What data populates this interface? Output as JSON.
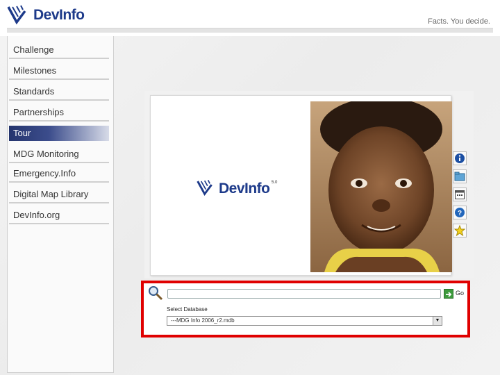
{
  "header": {
    "logo_text": "DevInfo",
    "tagline": "Facts. You decide."
  },
  "sidebar": {
    "items": [
      {
        "label": "Challenge",
        "active": false
      },
      {
        "label": "Milestones",
        "active": false
      },
      {
        "label": "Standards",
        "active": false
      },
      {
        "label": "Partnerships",
        "active": false
      },
      {
        "label": "Tour",
        "active": true
      },
      {
        "label": "MDG Monitoring",
        "active": false
      },
      {
        "label": "Emergency.Info",
        "active": false
      },
      {
        "label": "Digital Map Library",
        "active": false
      },
      {
        "label": "DevInfo.org",
        "active": false
      }
    ]
  },
  "main": {
    "logo_text": "DevInfo",
    "logo_mark": "5.0",
    "side_icons": [
      "info-icon",
      "folder-icon",
      "calendar-icon",
      "help-icon",
      "star-icon"
    ]
  },
  "search": {
    "input_value": "",
    "go_label": "Go",
    "db_label": "Select Database",
    "db_selected": "---MDG Info 2006_r2.mdb"
  },
  "colors": {
    "brand": "#1d3a8a",
    "active_nav": "#25356e",
    "highlight": "#e00000",
    "go_button": "#3d9a3d"
  }
}
